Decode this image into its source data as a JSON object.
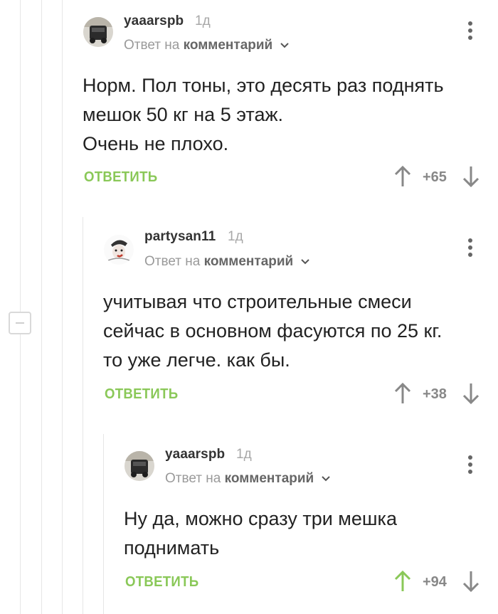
{
  "comments": [
    {
      "username": "yaaarspb",
      "time": "1д",
      "reply_prefix": "Ответ на",
      "reply_target": "комментарий",
      "text_lines": [
        "Норм. Пол тоны, это десять раз поднять",
        "мешок 50 кг на 5 этаж.",
        "Очень не плохо."
      ],
      "reply_label": "ОТВЕТИТЬ",
      "score": "+65",
      "upvoted": false
    },
    {
      "username": "partysan11",
      "time": "1д",
      "reply_prefix": "Ответ на",
      "reply_target": "комментарий",
      "text_lines": [
        "учитывая что строительные смеси",
        "сейчас в основном фасуются по 25 кг.",
        "то уже легче. как бы."
      ],
      "reply_label": "ОТВЕТИТЬ",
      "score": "+38",
      "upvoted": false
    },
    {
      "username": "yaaarspb",
      "time": "1д",
      "reply_prefix": "Ответ на",
      "reply_target": "комментарий",
      "text_lines": [
        "Ну да, можно сразу три мешка",
        "поднимать"
      ],
      "reply_label": "ОТВЕТИТЬ",
      "score": "+94",
      "upvoted": true
    }
  ],
  "colors": {
    "accent_green": "#8ac858",
    "thread_line": "#e6e6e6",
    "vote_gray": "#888888"
  }
}
